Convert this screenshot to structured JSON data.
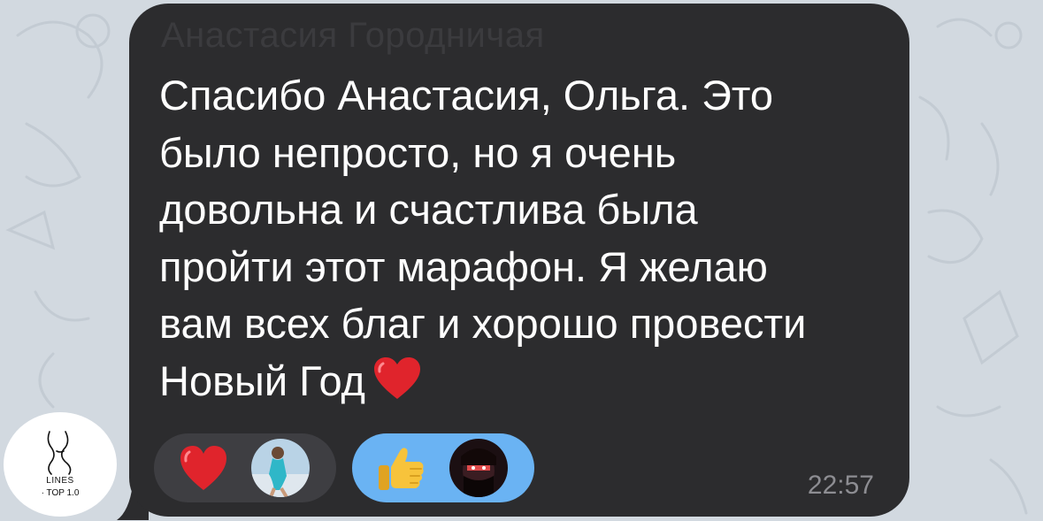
{
  "chat": {
    "sender_name": "Анастасия Городничая",
    "message_lines": [
      "Спасибо Анастасия, Ольга. Это",
      "было непросто, но я очень",
      "довольна и счастлива была",
      "пройти этот марафон. Я желаю",
      "вам всех благ и хорошо провести",
      "Новый Год"
    ],
    "trailing_emoji": "heart-emoji",
    "timestamp": "22:57"
  },
  "reactions": [
    {
      "emoji": "red-heart",
      "selected": false
    },
    {
      "emoji": "thumbs-up",
      "selected": true
    }
  ],
  "avatar": {
    "line1": "LINES",
    "line2": "· TOP 1.0"
  },
  "colors": {
    "background": "#d2d9e0",
    "bubble": "#2c2c2e",
    "text": "#ffffff",
    "timestamp": "#8d8d92",
    "reaction_default": "#3e3e42",
    "reaction_selected": "#6ab3f3",
    "heart": "#e0242c",
    "thumbs_up": "#f7c33b"
  }
}
